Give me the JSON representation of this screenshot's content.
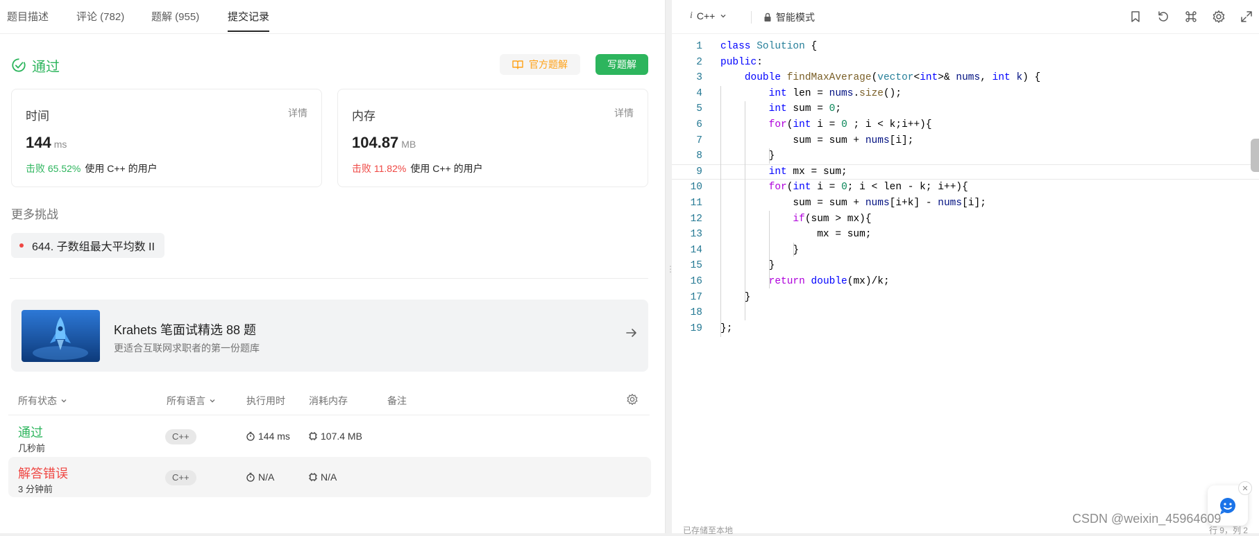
{
  "tabs": [
    {
      "label": "题目描述"
    },
    {
      "label": "评论 (782)"
    },
    {
      "label": "题解 (955)"
    },
    {
      "label": "提交记录"
    }
  ],
  "result": {
    "status": "通过",
    "official_solution_label": "官方题解",
    "write_solution_label": "写题解"
  },
  "time_card": {
    "label": "时间",
    "detail": "详情",
    "value": "144",
    "unit": "ms",
    "beat": "击败 65.52%",
    "suffix": "使用 C++ 的用户"
  },
  "memory_card": {
    "label": "内存",
    "detail": "详情",
    "value": "104.87",
    "unit": "MB",
    "beat": "击败 11.82%",
    "suffix": "使用 C++ 的用户"
  },
  "more": {
    "title": "更多挑战",
    "challenge": "644. 子数组最大平均数 II"
  },
  "promo": {
    "title": "Krahets 笔面试精选 88 题",
    "subtitle": "更适合互联网求职者的第一份题库"
  },
  "table": {
    "headers": {
      "status": "所有状态",
      "language": "所有语言",
      "runtime": "执行用时",
      "memory": "消耗内存",
      "notes": "备注"
    },
    "rows": [
      {
        "status": "通过",
        "time": "几秒前",
        "language": "C++",
        "runtime": "144 ms",
        "memory": "107.4 MB"
      },
      {
        "status": "解答错误",
        "time": "3 分钟前",
        "language": "C++",
        "runtime": "N/A",
        "memory": "N/A"
      }
    ]
  },
  "editor": {
    "language": "C++",
    "mode": "智能模式",
    "status_left": "已存储至本地",
    "status_right": "行 9，列 2"
  },
  "code_lines": [
    "class Solution {",
    "public:",
    "    double findMaxAverage(vector<int>& nums, int k) {",
    "        int len = nums.size();",
    "        int sum = 0;",
    "        for(int i = 0 ; i < k;i++){",
    "            sum = sum + nums[i];",
    "        }",
    "        int mx = sum;",
    "        for(int i = 0; i < len - k; i++){",
    "            sum = sum + nums[i+k] - nums[i];",
    "            if(sum > mx){",
    "                mx = sum;",
    "            }",
    "        }",
    "        return double(mx)/k;",
    "    }",
    "",
    "};"
  ],
  "watermark": "CSDN @weixin_45964609",
  "colors": {
    "accepted": "#2db55d",
    "wrong": "#ef4743",
    "official": "#ffa116"
  }
}
